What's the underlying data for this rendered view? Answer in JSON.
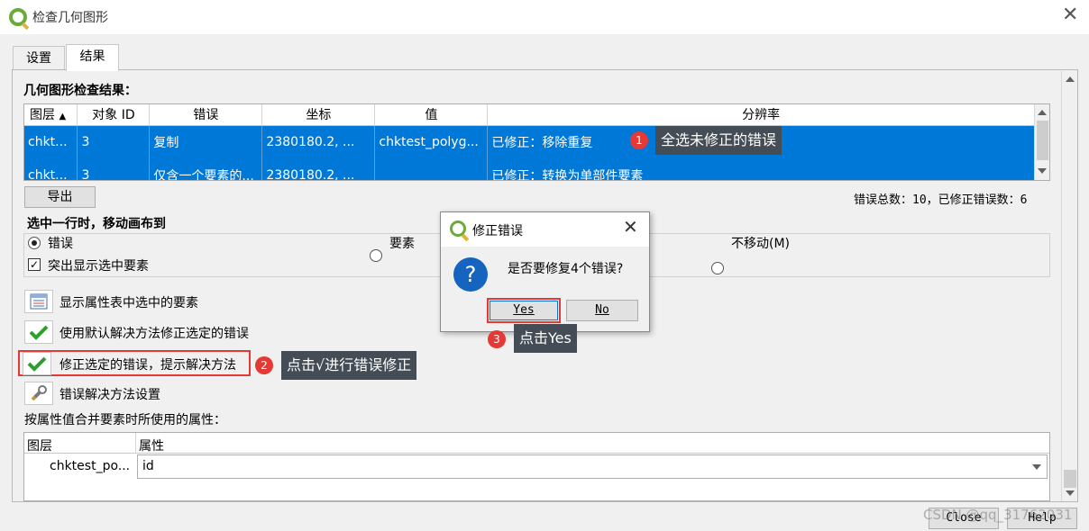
{
  "window": {
    "title": "检查几何图形"
  },
  "tabs": [
    {
      "label": "设置"
    },
    {
      "label": "结果"
    }
  ],
  "results": {
    "heading": "几何图形检查结果：",
    "columns": [
      "图层",
      "对象 ID",
      "错误",
      "坐标",
      "值",
      "分辨率"
    ],
    "rows": [
      [
        "chkt...",
        "3",
        "复制",
        "2380180.2, ...",
        "chktest_polyg...",
        "已修正：移除重复"
      ],
      [
        "chkt...",
        "3",
        "仅含一个要素的...",
        "2380180.2, ...",
        "",
        "已修正：转换为单部件要素"
      ]
    ],
    "export_label": "导出",
    "summary": "错误总数：10，已修正错误数：6"
  },
  "move_section": {
    "heading": "选中一行时，移动画布到",
    "options": [
      "错误",
      "要素",
      "不移动(M)"
    ],
    "highlight": "突出显示选中要素"
  },
  "actions": [
    {
      "label": "显示属性表中选中的要素"
    },
    {
      "label": "使用默认解决方法修正选定的错误"
    },
    {
      "label": "修正选定的错误，提示解决方法"
    },
    {
      "label": "错误解决方法设置"
    }
  ],
  "merge": {
    "heading": "按属性值合并要素时所使用的属性：",
    "columns": [
      "图层",
      "属性"
    ],
    "row": {
      "layer": "chktest_po...",
      "attr": "id"
    }
  },
  "dialog": {
    "title": "修正错误",
    "message": "是否要修复4个错误?",
    "yes": "Yes",
    "no": "No"
  },
  "callouts": [
    {
      "badge": "1",
      "text": "全选未修正的错误"
    },
    {
      "badge": "2",
      "text": "点击√进行错误修正"
    },
    {
      "badge": "3",
      "text": "点击Yes"
    }
  ],
  "footer": {
    "close": "Close",
    "help": "Help",
    "watermark": "CSDN @qq_31762031"
  },
  "colors": {
    "selection": "#0078d7",
    "callout": "#444c55",
    "badge": "#e53935",
    "highlight_box": "#e53935"
  }
}
